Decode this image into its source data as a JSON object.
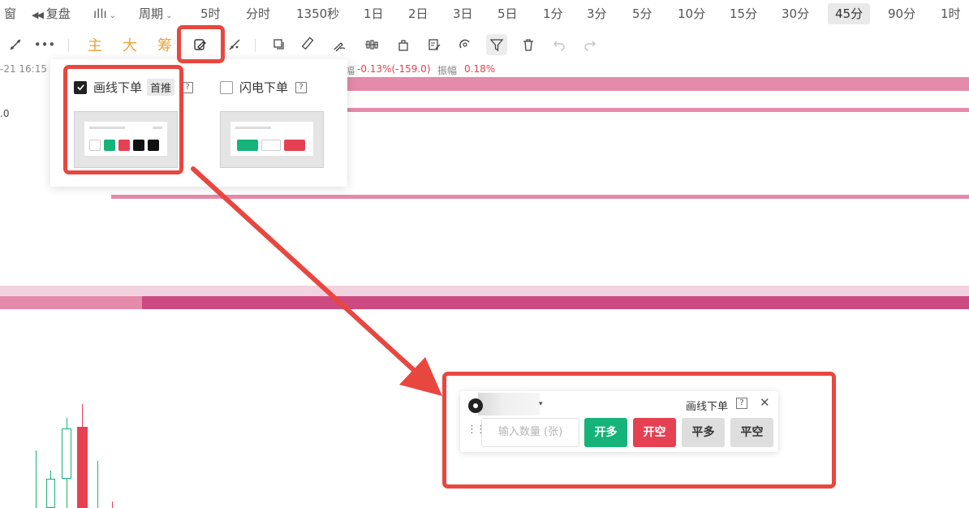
{
  "topbar": {
    "window_label": "窗",
    "replay_label": "复盘",
    "indicator_label": "ıllı",
    "period_label": "周期",
    "periods": [
      "5时",
      "分时",
      "1350秒",
      "1日",
      "2日",
      "3日",
      "5日",
      "1分",
      "3分",
      "5分",
      "10分",
      "15分",
      "30分",
      "45分",
      "90分",
      "1时"
    ],
    "active_period": "45分"
  },
  "toolbar": {
    "more_label": "•••",
    "indicator_main": "主",
    "indicator_big": "大",
    "indicator_chip": "筹"
  },
  "info_line": {
    "time_text": "-21 16:15",
    "change_prefix": "幅",
    "change_value": "-0.13%(-159.0)",
    "amplitude_label": "振幅",
    "amplitude_value": "0.18%",
    "axis_value": ".0"
  },
  "popover": {
    "option1": {
      "label": "画线下单",
      "tag": "首推",
      "checked": true,
      "help": "?"
    },
    "option2": {
      "label": "闪电下单",
      "checked": false,
      "help": "?"
    }
  },
  "order_panel": {
    "title": "画线下单",
    "help": "?",
    "close": "✕",
    "dropdown": "▾",
    "drag": "⋮⋮",
    "quantity_placeholder": "输入数量 (张)",
    "buttons": {
      "open_long": "开多",
      "open_short": "开空",
      "close_long": "平多",
      "close_short": "平空"
    }
  },
  "colors": {
    "accent_red": "#e8473f",
    "up_green": "#16b37a",
    "down_red": "#e54152",
    "band_pink": "#e48aab",
    "band_magenta": "#cd4a80",
    "indicator_orange": "#e8a33b"
  }
}
